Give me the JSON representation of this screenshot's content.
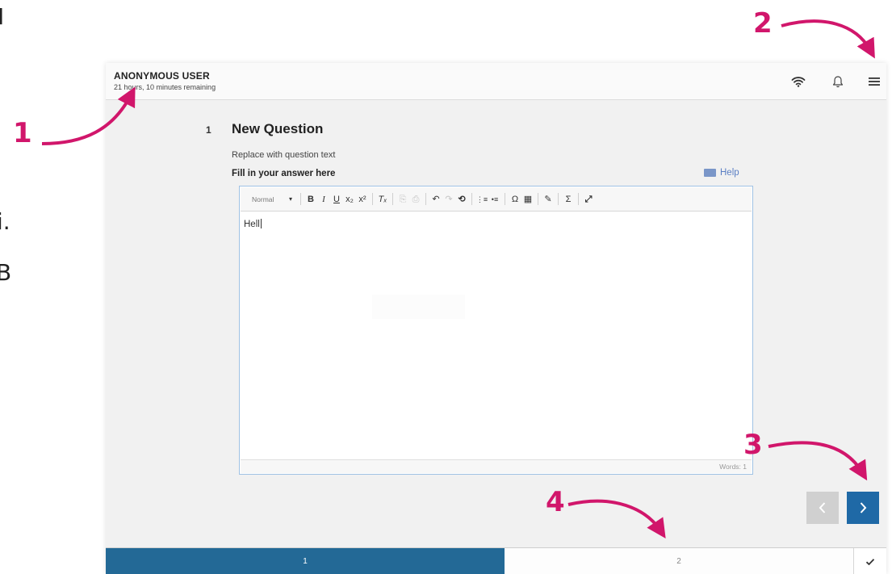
{
  "slide_fragments": [
    "I",
    "i.",
    "B"
  ],
  "header": {
    "user_name": "ANONYMOUS USER",
    "time_remaining": "21 hours, 10 minutes remaining",
    "icons": [
      "wifi-icon",
      "bell-icon",
      "menu-icon"
    ]
  },
  "question": {
    "number": "1",
    "title": "New Question",
    "text": "Replace with question text",
    "prompt": "Fill in your answer here",
    "help_label": "Help"
  },
  "editor": {
    "format_value": "Normal",
    "toolbar": [
      "▾",
      "B",
      "I",
      "U",
      "x₂",
      "x²",
      "Tₓ",
      "⎘",
      "⎙",
      "↶",
      "↷",
      "⟲",
      "⋮≡",
      "•≡",
      "Ω",
      "▦",
      "✎",
      "Σ",
      "⤢"
    ],
    "content": "Hell",
    "word_count": "Words: 1"
  },
  "pages": {
    "items": [
      "1",
      "2"
    ],
    "current": "1"
  },
  "annotations": [
    "1",
    "2",
    "3",
    "4"
  ],
  "colors": {
    "accent": "#1f69a6",
    "annotation": "#d1166b",
    "page_active": "#236996"
  }
}
